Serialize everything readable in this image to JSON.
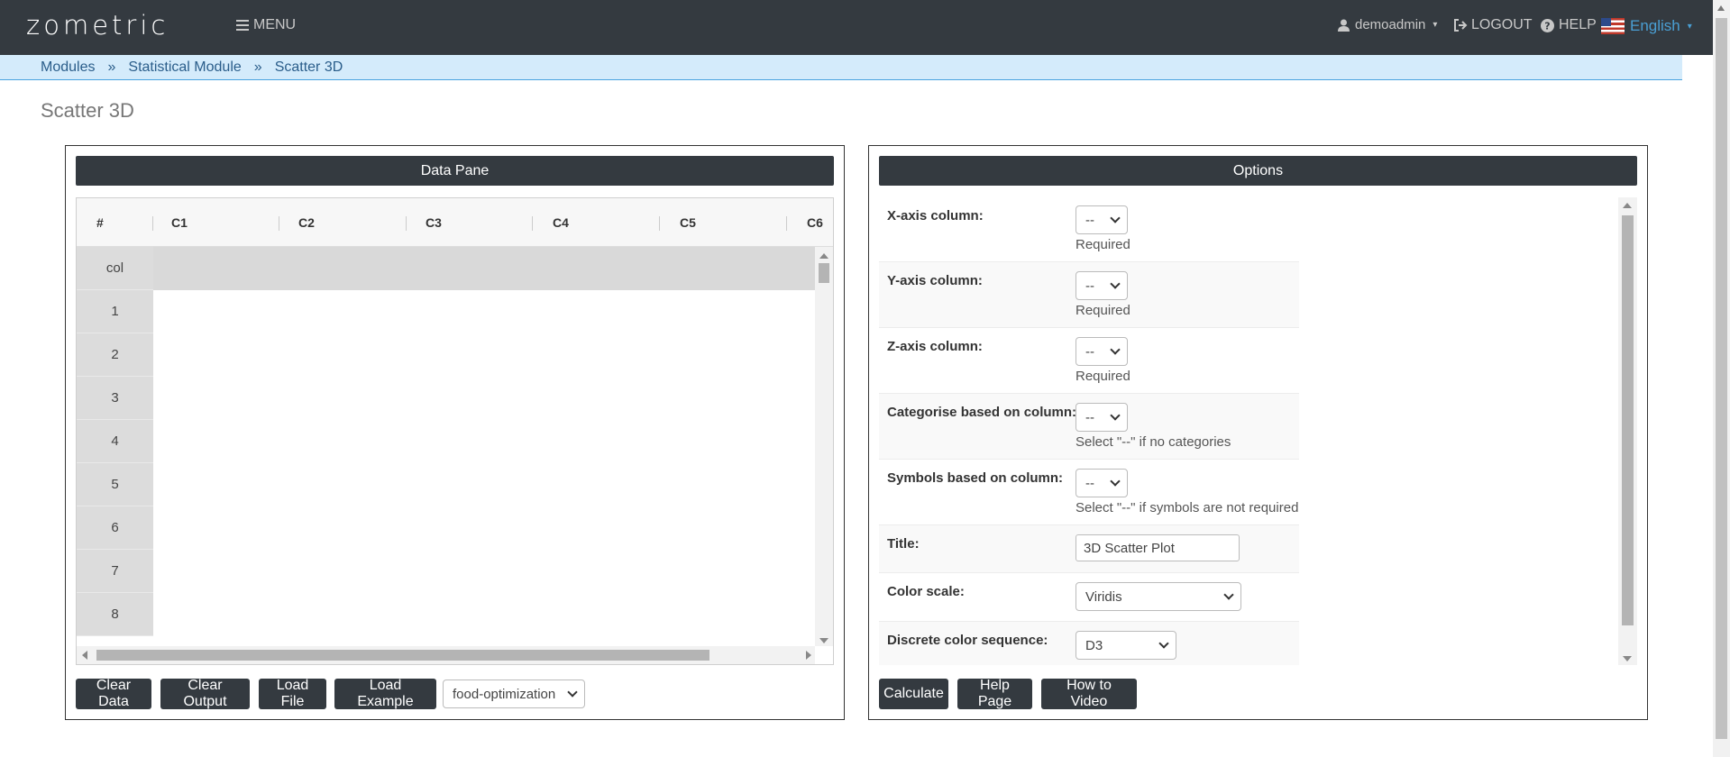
{
  "app": {
    "logo": "zometric"
  },
  "nav": {
    "menu_label": "MENU",
    "user_label": "demoadmin",
    "logout_label": "LOGOUT",
    "help_label": "HELP",
    "language_label": "English"
  },
  "breadcrumb": {
    "items": [
      "Modules",
      "Statistical Module",
      "Scatter 3D"
    ],
    "separator": "»"
  },
  "page": {
    "title": "Scatter 3D"
  },
  "data_pane": {
    "header": "Data Pane",
    "columns": [
      "#",
      "C1",
      "C2",
      "C3",
      "C4",
      "C5",
      "C6"
    ],
    "rows": [
      "col",
      "1",
      "2",
      "3",
      "4",
      "5",
      "6",
      "7",
      "8"
    ],
    "buttons": {
      "clear_data": "Clear Data",
      "clear_output": "Clear Output",
      "load_file": "Load File",
      "load_example": "Load Example"
    },
    "example_select": "food-optimization"
  },
  "options": {
    "header": "Options",
    "fields": [
      {
        "label": "X-axis column:",
        "value": "--",
        "help": "Required"
      },
      {
        "label": "Y-axis column:",
        "value": "--",
        "help": "Required"
      },
      {
        "label": "Z-axis column:",
        "value": "--",
        "help": "Required"
      },
      {
        "label": "Categorise based on column:",
        "value": "--",
        "help": "Select \"--\" if no categories"
      },
      {
        "label": "Symbols based on column:",
        "value": "--",
        "help": "Select \"--\" if symbols are not required"
      }
    ],
    "title_label": "Title:",
    "title_value": "3D Scatter Plot",
    "color_scale_label": "Color scale:",
    "color_scale_value": "Viridis",
    "discrete_label": "Discrete color sequence:",
    "discrete_value": "D3",
    "buttons": {
      "calculate": "Calculate",
      "help_page": "Help Page",
      "how_to_video": "How to Video"
    }
  },
  "colors": {
    "navbar": "#343a40",
    "breadcrumb_bg": "#d4ebfb",
    "link": "#2a5d8a",
    "language": "#4a9fd4"
  }
}
